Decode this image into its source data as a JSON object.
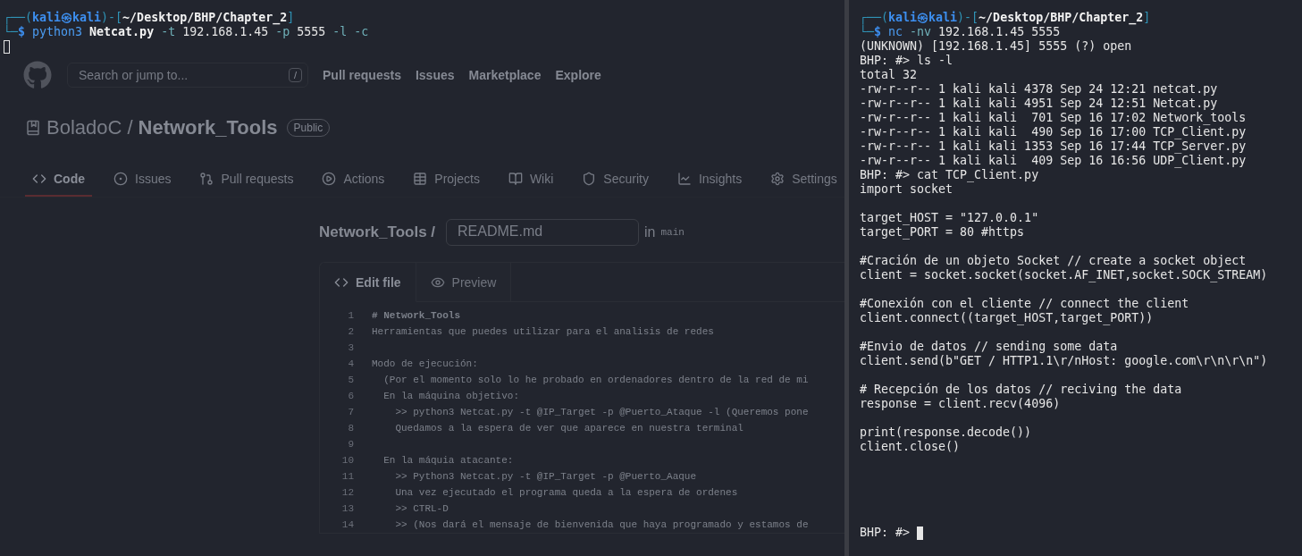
{
  "browser": {
    "search": {
      "placeholder": "Search or jump to...",
      "shortcut": "/"
    },
    "header_links": [
      "Pull requests",
      "Issues",
      "Marketplace",
      "Explore"
    ],
    "repo": {
      "owner": "BoladoC",
      "separator": "/",
      "name": "Network_Tools",
      "visibility": "Public"
    },
    "tabs": [
      {
        "label": "Code",
        "kind": "code",
        "selected": true
      },
      {
        "label": "Issues",
        "kind": "issues",
        "selected": false
      },
      {
        "label": "Pull requests",
        "kind": "pulls",
        "selected": false
      },
      {
        "label": "Actions",
        "kind": "actions",
        "selected": false
      },
      {
        "label": "Projects",
        "kind": "projects",
        "selected": false
      },
      {
        "label": "Wiki",
        "kind": "wiki",
        "selected": false
      },
      {
        "label": "Security",
        "kind": "security",
        "selected": false
      },
      {
        "label": "Insights",
        "kind": "insights",
        "selected": false
      },
      {
        "label": "Settings",
        "kind": "settings",
        "selected": false
      }
    ],
    "editor": {
      "repo": "Network_Tools /",
      "filename": "README.md",
      "branch_prefix": "in",
      "branch": "main",
      "tabs": [
        {
          "label": "Edit file",
          "kind": "edit",
          "selected": true
        },
        {
          "label": "Preview",
          "kind": "preview",
          "selected": false
        }
      ],
      "lines": [
        {
          "number": "1",
          "text": "# Network_Tools",
          "kind": "heading"
        },
        {
          "number": "2",
          "text": "Herramientas que puedes utilizar para el analisis de redes",
          "kind": "text"
        },
        {
          "number": "3",
          "kind": "blank"
        },
        {
          "number": "4",
          "text": "Modo de ejecución:",
          "kind": "text"
        },
        {
          "number": "5",
          "text": "  (Por el momento solo lo he probado en ordenadores dentro de la red de mi",
          "kind": "text"
        },
        {
          "number": "6",
          "text": "  En la máquina objetivo:",
          "kind": "text"
        },
        {
          "number": "7",
          "text": "    >> python3 Netcat.py -t @IP_Target -p @Puerto_Ataque -l (Queremos pone",
          "kind": "text"
        },
        {
          "number": "8",
          "text": "    Quedamos a la espera de ver que aparece en nuestra terminal",
          "kind": "text"
        },
        {
          "number": "9",
          "kind": "blank"
        },
        {
          "number": "10",
          "text": "  En la máquia atacante:",
          "kind": "text"
        },
        {
          "number": "11",
          "text": "    >> Python3 Netcat.py -t @IP_Target -p @Puerto_Aaque",
          "kind": "text"
        },
        {
          "number": "12",
          "text": "    Una vez ejecutado el programa queda a la espera de ordenes",
          "kind": "text"
        },
        {
          "number": "13",
          "text": "    >> CTRL-D",
          "kind": "text"
        },
        {
          "number": "14",
          "text": "    >> (Nos dará el mensaje de bienvenida que haya programado y estamos de",
          "kind": "text"
        }
      ]
    }
  },
  "terminals": [
    {
      "lines": [
        {
          "kind": "prompt",
          "segments": [
            {
              "text": "┌──(",
              "kind": "frame"
            },
            {
              "text": "kali㉿kali",
              "kind": "user"
            },
            {
              "text": ")-[",
              "kind": "frame"
            },
            {
              "text": "~/Desktop/BHP/Chapter_2",
              "kind": "path"
            },
            {
              "text": "]",
              "kind": "frame"
            }
          ]
        },
        {
          "kind": "prompt",
          "segments": [
            {
              "text": "└─",
              "kind": "frame"
            },
            {
              "text": "$",
              "kind": "sigil"
            },
            {
              "text": " python3",
              "kind": "command"
            },
            {
              "text": " Netcat.py",
              "kind": "file"
            },
            {
              "text": " -t",
              "kind": "option"
            },
            {
              "text": " 192.168.1.45",
              "kind": "arg"
            },
            {
              "text": " -p",
              "kind": "option"
            },
            {
              "text": " 5555",
              "kind": "arg"
            },
            {
              "text": " -l -c",
              "kind": "option"
            }
          ]
        },
        {
          "kind": "cursor",
          "focused": false
        }
      ]
    },
    {
      "lines": [
        {
          "kind": "prompt",
          "segments": [
            {
              "text": "┌──(",
              "kind": "frame"
            },
            {
              "text": "kali㉿kali",
              "kind": "user"
            },
            {
              "text": ")-[",
              "kind": "frame"
            },
            {
              "text": "~/Desktop/BHP/Chapter_2",
              "kind": "path"
            },
            {
              "text": "]",
              "kind": "frame"
            }
          ]
        },
        {
          "kind": "prompt",
          "segments": [
            {
              "text": "└─",
              "kind": "frame"
            },
            {
              "text": "$",
              "kind": "sigil"
            },
            {
              "text": " nc",
              "kind": "command"
            },
            {
              "text": " -nv",
              "kind": "option"
            },
            {
              "text": " 192.168.1.45 5555",
              "kind": "arg"
            }
          ]
        },
        {
          "kind": "text",
          "text": "(UNKNOWN) [192.168.1.45] 5555 (?) open"
        },
        {
          "kind": "text",
          "text": "BHP: #> ls -l"
        },
        {
          "kind": "text",
          "text": "total 32"
        },
        {
          "kind": "text",
          "text": "-rw-r--r-- 1 kali kali 4378 Sep 24 12:21 netcat.py"
        },
        {
          "kind": "text",
          "text": "-rw-r--r-- 1 kali kali 4951 Sep 24 12:51 Netcat.py"
        },
        {
          "kind": "text",
          "text": "-rw-r--r-- 1 kali kali  701 Sep 16 17:02 Network_tools"
        },
        {
          "kind": "text",
          "text": "-rw-r--r-- 1 kali kali  490 Sep 16 17:00 TCP_Client.py"
        },
        {
          "kind": "text",
          "text": "-rw-r--r-- 1 kali kali 1353 Sep 16 17:44 TCP_Server.py"
        },
        {
          "kind": "text",
          "text": "-rw-r--r-- 1 kali kali  409 Sep 16 16:56 UDP_Client.py"
        },
        {
          "kind": "text",
          "text": "BHP: #> cat TCP_Client.py"
        },
        {
          "kind": "text",
          "text": "import socket"
        },
        {
          "kind": "blank"
        },
        {
          "kind": "text",
          "text": "target_HOST = \"127.0.0.1\""
        },
        {
          "kind": "text",
          "text": "target_PORT = 80 #https"
        },
        {
          "kind": "blank"
        },
        {
          "kind": "text",
          "text": "#Cración de un objeto Socket // create a socket object"
        },
        {
          "kind": "text",
          "text": "client = socket.socket(socket.AF_INET,socket.SOCK_STREAM)"
        },
        {
          "kind": "blank"
        },
        {
          "kind": "text",
          "text": "#Conexión con el cliente // connect the client"
        },
        {
          "kind": "text",
          "text": "client.connect((target_HOST,target_PORT))"
        },
        {
          "kind": "blank"
        },
        {
          "kind": "text",
          "text": "#Envio de datos // sending some data"
        },
        {
          "kind": "text",
          "text": "client.send(b\"GET / HTTP1.1\\r/nHost: google.com\\r\\n\\r\\n\")"
        },
        {
          "kind": "blank"
        },
        {
          "kind": "text",
          "text": "# Recepción de los datos // reciving the data"
        },
        {
          "kind": "text",
          "text": "response = client.recv(4096)"
        },
        {
          "kind": "blank"
        },
        {
          "kind": "text",
          "text": "print(response.decode())"
        },
        {
          "kind": "text",
          "text": "client.close()"
        },
        {
          "kind": "blank"
        },
        {
          "kind": "blank"
        },
        {
          "kind": "blank"
        },
        {
          "kind": "blank"
        },
        {
          "kind": "blank"
        },
        {
          "kind": "cursor",
          "prefix": "BHP: #> ",
          "focused": true
        }
      ]
    }
  ]
}
